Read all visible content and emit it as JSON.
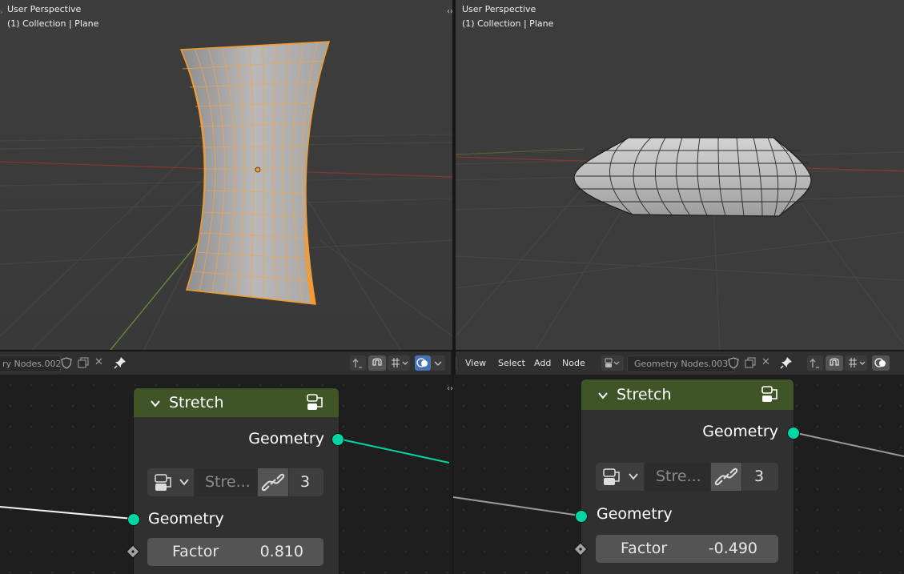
{
  "left_viewport": {
    "perspective": "User Perspective",
    "collection": "(1) Collection | Plane"
  },
  "right_viewport": {
    "perspective": "User Perspective",
    "collection": "(1) Collection | Plane"
  },
  "left_header": {
    "datablock_name": "ry Nodes.002"
  },
  "right_header": {
    "menu": [
      "View",
      "Select",
      "Add",
      "Node"
    ],
    "datablock_name": "Geometry Nodes.003"
  },
  "left_node": {
    "title": "Stretch",
    "output_socket": "Geometry",
    "group_name": "Stre...",
    "user_count": "3",
    "input_socket": "Geometry",
    "factor_label": "Factor",
    "factor_value": "0.810"
  },
  "right_node": {
    "title": "Stretch",
    "output_socket": "Geometry",
    "group_name": "Stre...",
    "user_count": "3",
    "input_socket": "Geometry",
    "factor_label": "Factor",
    "factor_value": "-0.490"
  },
  "colors": {
    "selection_orange": "#f49b2e",
    "geometry_socket": "#00d6a3",
    "node_header_green": "#3f5427",
    "viewport_bg": "#3c3c3c",
    "x_axis_red": "#9e3a3a",
    "y_axis_green": "#6f9a3a"
  }
}
